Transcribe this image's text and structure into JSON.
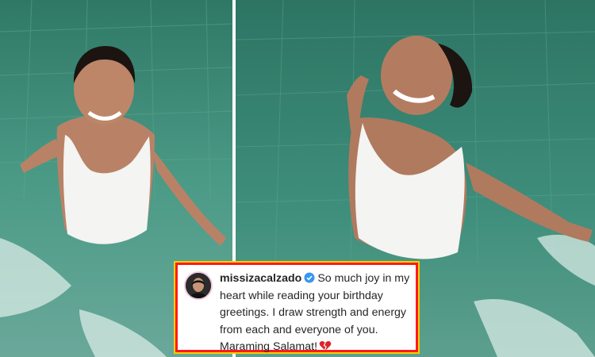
{
  "photos": {
    "left_alt": "Woman in white swimsuit smiling in green pool water",
    "right_alt": "Woman in white swimsuit with eyes closed, arms outstretched in pool"
  },
  "caption": {
    "username": "missizacalzado",
    "text": "So much joy in my heart while reading your birthday greetings. I draw strength and energy from each and everyone of you. Maraming Salamat!",
    "verified_icon": "verified-badge-icon",
    "heart_icon": "broken-heart-icon"
  },
  "colors": {
    "border_red": "#ff1a1a",
    "border_yellow": "#f1d000",
    "verified_blue": "#3897f0",
    "heart_red": "#d9262b",
    "water": "#3f8f7c"
  }
}
